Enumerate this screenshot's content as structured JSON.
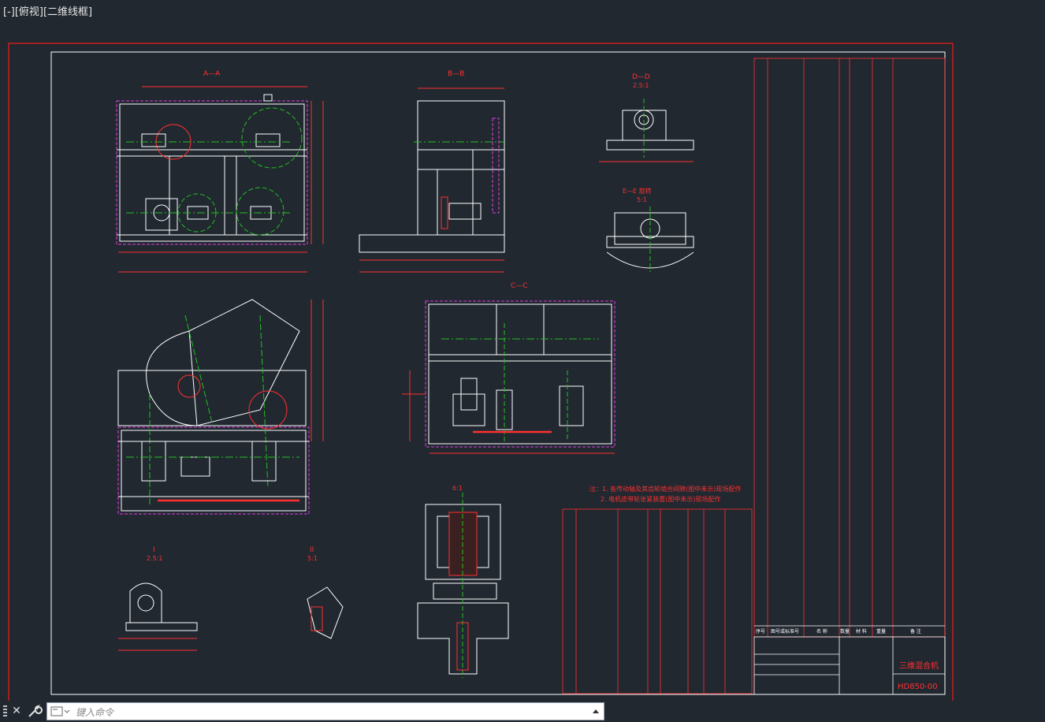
{
  "viewport_label": "[-][俯视][二维线框]",
  "colors": {
    "background": "#212830",
    "outer_frame": "#c81e1e",
    "drawing_lines": "#ffffff",
    "annotation": "#ff3030",
    "centerline": "#22c022",
    "hidden": "#e040e0",
    "dimension": "#ff2020"
  },
  "views": {
    "aa": "A—A",
    "bb": "B—B",
    "cc": "C—C",
    "dd": "D—D",
    "dd_scale": "2.5:1",
    "ee": "E—E 旋转",
    "ee_scale": "5:1",
    "detail_i": "I",
    "detail_i_scale": "2.5:1",
    "detail_ii": "II",
    "detail_ii_scale": "5:1",
    "six_scale": "6:1"
  },
  "notes": {
    "line1": "注：1. 各传动轴及其齿轮啮合间隙(图中未示)现场配作",
    "line2": "2. 电机皮带轮张紧装置(图中未示)现场配作"
  },
  "title_block": {
    "title": "三维混合机",
    "drawing_no": "HD850-00"
  },
  "bom_header": {
    "seq": "序号",
    "code": "图号或标准号",
    "name": "名 称",
    "qty": "数量",
    "material": "材 料",
    "weight": "重量",
    "remark": "备 注"
  }
}
